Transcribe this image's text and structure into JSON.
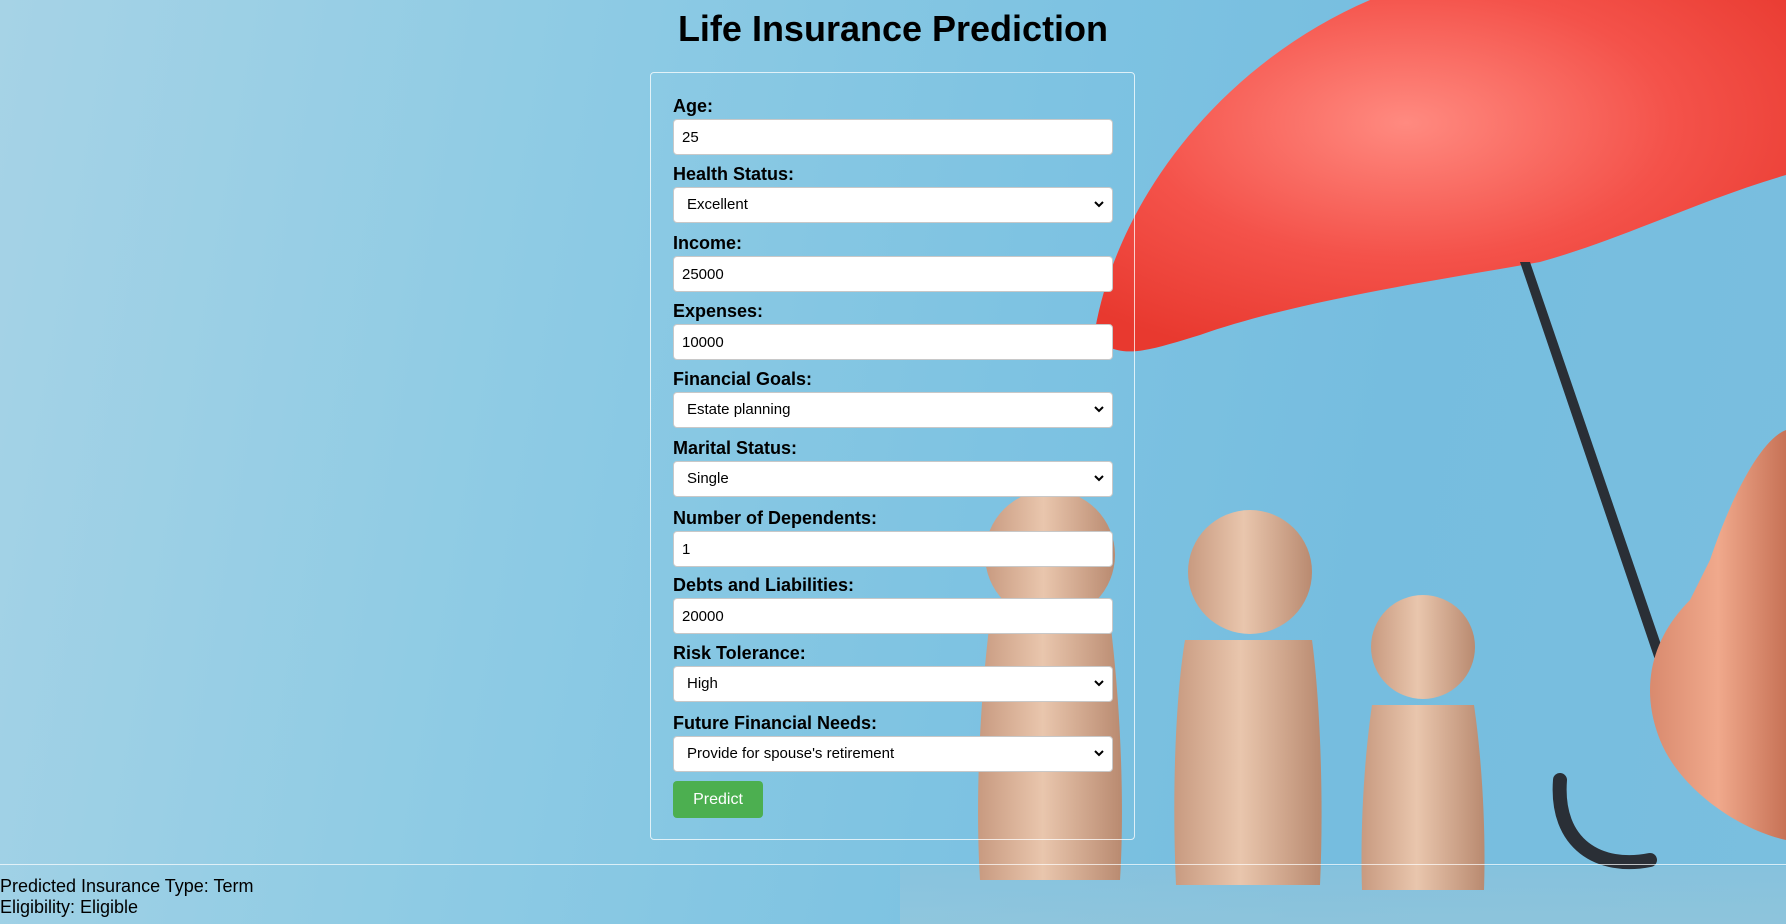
{
  "page": {
    "title": "Life Insurance Prediction"
  },
  "form": {
    "age": {
      "label": "Age:",
      "value": "25"
    },
    "health_status": {
      "label": "Health Status:",
      "value": "Excellent"
    },
    "income": {
      "label": "Income:",
      "value": "25000"
    },
    "expenses": {
      "label": "Expenses:",
      "value": "10000"
    },
    "financial_goals": {
      "label": "Financial Goals:",
      "value": "Estate planning"
    },
    "marital_status": {
      "label": "Marital Status:",
      "value": "Single"
    },
    "dependents": {
      "label": "Number of Dependents:",
      "value": "1"
    },
    "debts": {
      "label": "Debts and Liabilities:",
      "value": "20000"
    },
    "risk_tolerance": {
      "label": "Risk Tolerance:",
      "value": "High"
    },
    "future_needs": {
      "label": "Future Financial Needs:",
      "value": "Provide for spouse's retirement"
    },
    "predict_label": "Predict"
  },
  "results": {
    "insurance_type": "Predicted Insurance Type: Term",
    "eligibility": "Eligibility: Eligible"
  },
  "colors": {
    "background": "#8ecbe4",
    "button": "#4caf50",
    "umbrella": "#f4524a"
  },
  "icons": {
    "select_arrow": "chevron-down-icon"
  }
}
